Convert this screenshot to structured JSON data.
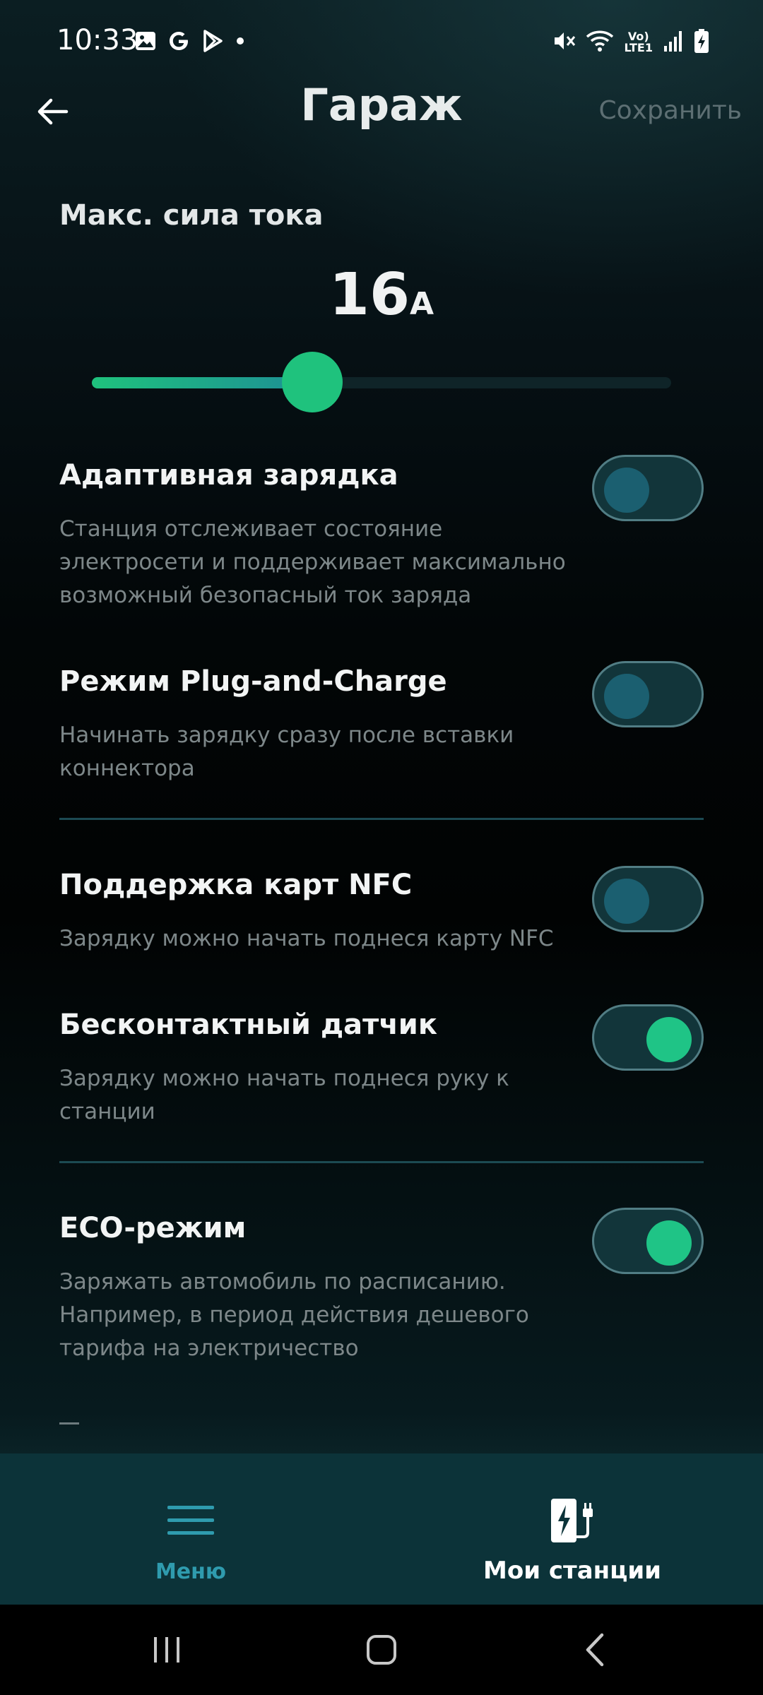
{
  "status_bar": {
    "time": "10:33",
    "left_icons": [
      "image-icon",
      "google-icon",
      "play-store-icon",
      "dot-icon"
    ],
    "right_icons": [
      "mute-icon",
      "wifi-icon",
      "volte-lte-icon",
      "signal-icon",
      "battery-charging-icon"
    ],
    "lte_line1": "Vo)",
    "lte_line2": "LTE1"
  },
  "header": {
    "title": "Гараж",
    "save_label": "Сохранить"
  },
  "current": {
    "label": "Макс. сила тока",
    "value": "16",
    "unit": "A",
    "slider_fraction": 0.38
  },
  "settings": [
    {
      "title": "Адаптивная зарядка",
      "description": "Станция отслеживает состояние электросети и поддерживает максимально возможный безопасный ток заряда",
      "enabled": false
    },
    {
      "title": "Режим Plug-and-Charge",
      "description": "Начинать зарядку сразу после вставки коннектора",
      "enabled": false
    },
    {
      "title": "Поддержка карт NFC",
      "description": "Зарядку можно начать поднеся карту NFC",
      "enabled": false
    },
    {
      "title": "Бесконтактный датчик",
      "description": "Зарядку можно начать поднеся руку к станции",
      "enabled": true
    },
    {
      "title": "ECO-режим",
      "description": "Заряжать автомобиль по расписанию. Например, в период действия дешевого тарифа на электричество",
      "enabled": true
    }
  ],
  "bottom_nav": {
    "menu_label": "Меню",
    "stations_label": "Мои станции"
  },
  "colors": {
    "accent_green": "#1fc27d",
    "nav_background": "#0c3339",
    "menu_teal": "#2f9bae"
  }
}
